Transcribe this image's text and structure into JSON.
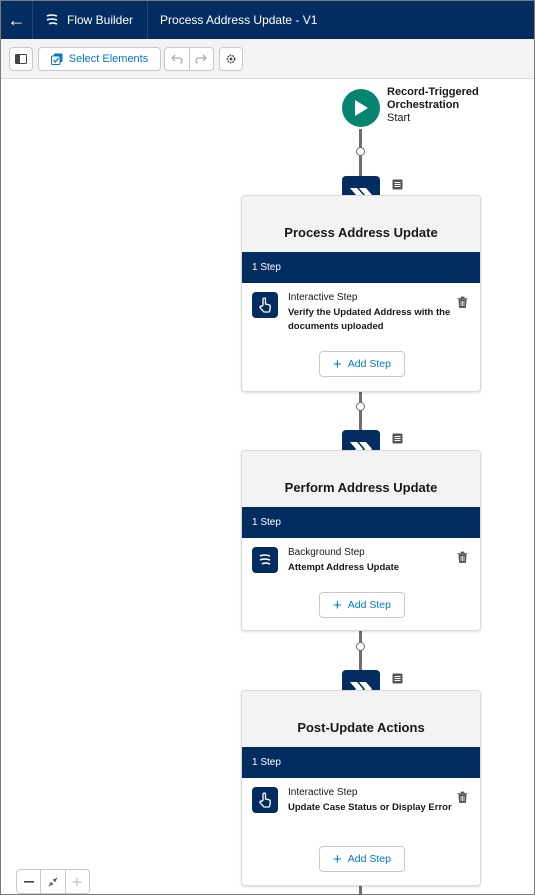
{
  "header": {
    "app_name": "Flow Builder",
    "flow_title": "Process Address Update - V1"
  },
  "toolbar": {
    "select_elements_label": "Select Elements"
  },
  "start": {
    "title_line1": "Record-Triggered",
    "title_line2": "Orchestration",
    "subtitle": "Start"
  },
  "stages": [
    {
      "title": "Process Address Update",
      "steps_count": "1 Step",
      "step_type": "Interactive Step",
      "step_name": "Verify the Updated Address with the documents uploaded",
      "add_step_label": "Add Step"
    },
    {
      "title": "Perform Address Update",
      "steps_count": "1 Step",
      "step_type": "Background Step",
      "step_name": "Attempt Address Update",
      "add_step_label": "Add Step"
    },
    {
      "title": "Post-Update Actions",
      "steps_count": "1 Step",
      "step_type": "Interactive Step",
      "step_name": "Update Case Status or Display Error",
      "add_step_label": "Add Step"
    }
  ],
  "colors": {
    "header_bg": "#032d60",
    "start_green": "#06846e",
    "link_blue": "#0176d3"
  },
  "icons": {
    "back": "back-arrow-icon",
    "app": "flow-icon",
    "panel": "toggle-panel-icon",
    "select": "select-elements-icon",
    "undo": "undo-icon",
    "redo": "redo-icon",
    "settings": "gear-icon",
    "stage": "stage-chevron-icon",
    "note": "note-icon",
    "interactive": "hand-touch-icon",
    "background": "flow-icon",
    "delete": "trash-icon",
    "zoom_out": "minus-icon",
    "fit": "fit-view-icon",
    "zoom_in": "plus-icon"
  }
}
